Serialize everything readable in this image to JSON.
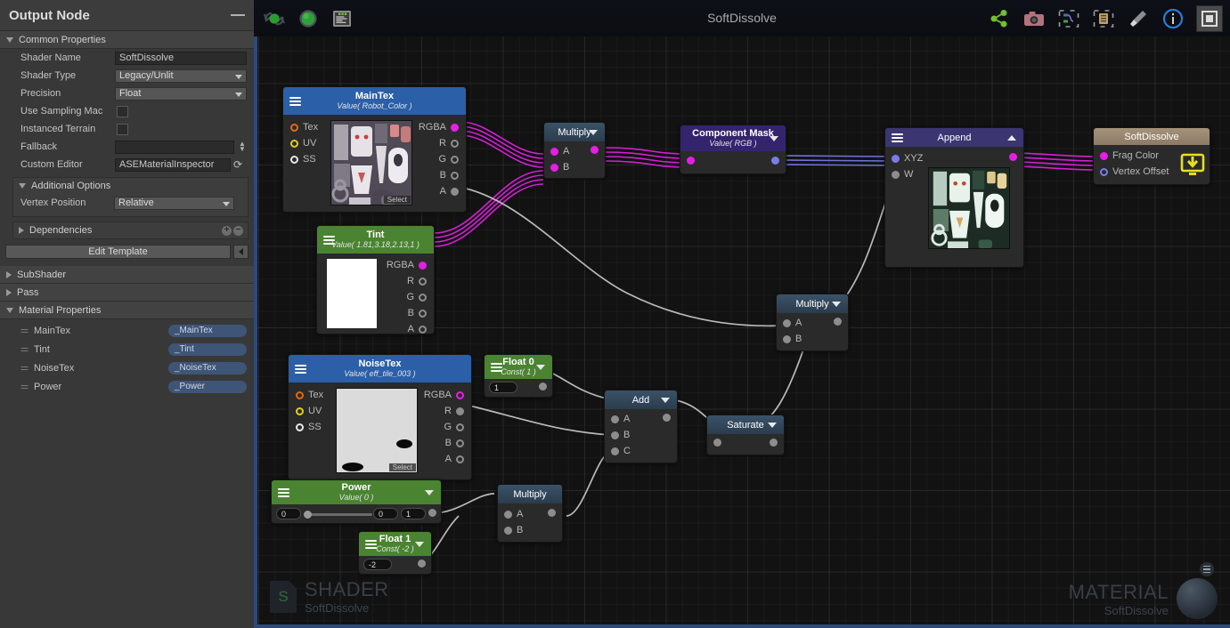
{
  "sidebar": {
    "title": "Output Node",
    "minimize_icon": "minimize-icon",
    "sections": {
      "common_properties": "Common Properties",
      "additional_options": "Additional Options",
      "dependencies": "Dependencies",
      "subshader": "SubShader",
      "pass": "Pass",
      "material_properties": "Material Properties"
    },
    "fields": {
      "shader_name_label": "Shader Name",
      "shader_name_value": "SoftDissolve",
      "shader_type_label": "Shader Type",
      "shader_type_value": "Legacy/Unlit",
      "precision_label": "Precision",
      "precision_value": "Float",
      "use_sampling_macros_label": "Use Sampling Mac",
      "instanced_terrain_label": "Instanced Terrain",
      "fallback_label": "Fallback",
      "fallback_value": "",
      "custom_editor_label": "Custom Editor",
      "custom_editor_value": "ASEMaterialInspector",
      "vertex_position_label": "Vertex Position",
      "vertex_position_value": "Relative"
    },
    "edit_template_button": "Edit Template",
    "material_properties": [
      {
        "name": "MainTex",
        "property": "_MainTex"
      },
      {
        "name": "Tint",
        "property": "_Tint"
      },
      {
        "name": "NoiseTex",
        "property": "_NoiseTex"
      },
      {
        "name": "Power",
        "property": "_Power"
      }
    ]
  },
  "graph": {
    "title": "SoftDissolve",
    "toolbar_left": [
      "live-update-icon",
      "green-sphere-icon",
      "shader-code-icon"
    ],
    "toolbar_right": [
      "share-icon",
      "camera-icon",
      "focus-nodes-icon",
      "focus-selection-icon",
      "cleanup-broom-icon",
      "info-icon",
      "minimap-panel-icon"
    ],
    "watermark_shader": {
      "kind": "SHADER",
      "name": "SoftDissolve",
      "badge": "S"
    },
    "watermark_material": {
      "kind": "MATERIAL",
      "name": "SoftDissolve"
    },
    "nodes": [
      {
        "id": "maintex",
        "title": "MainTex",
        "subtitle": "Value( Robot_Color )",
        "header_color": "#2b5fa8",
        "inputs": [
          {
            "label": "Tex",
            "style": "hollow-orange"
          },
          {
            "label": "UV",
            "style": "hollow-yellow"
          },
          {
            "label": "SS",
            "style": "hollow-white"
          }
        ],
        "outputs": [
          {
            "label": "RGBA",
            "style": "mag"
          },
          {
            "label": "R",
            "style": "hollow-grey"
          },
          {
            "label": "G",
            "style": "hollow-grey"
          },
          {
            "label": "B",
            "style": "hollow-grey"
          },
          {
            "label": "A",
            "style": "grey"
          }
        ],
        "preview": "robot-color-texture",
        "preview_label": "Select"
      },
      {
        "id": "tint",
        "title": "Tint",
        "subtitle": "Value( 1.81,3.18,2.13,1 )",
        "header_color": "#4a8431",
        "outputs": [
          {
            "label": "RGBA",
            "style": "mag"
          },
          {
            "label": "R",
            "style": "hollow-grey"
          },
          {
            "label": "G",
            "style": "hollow-grey"
          },
          {
            "label": "B",
            "style": "hollow-grey"
          },
          {
            "label": "A",
            "style": "hollow-grey"
          }
        ],
        "preview": "white-color-swatch"
      },
      {
        "id": "multiply_top",
        "title": "Multiply",
        "header_color": "#30455c",
        "inputs": [
          {
            "label": "A",
            "style": "mag"
          },
          {
            "label": "B",
            "style": "mag"
          }
        ],
        "outputs": [
          {
            "label": "",
            "style": "mag"
          }
        ]
      },
      {
        "id": "component_mask",
        "title": "Component Mask",
        "subtitle": "Value( RGB )",
        "header_color": "#34246d",
        "inputs": [
          {
            "label": "",
            "style": "mag"
          }
        ],
        "outputs": [
          {
            "label": "",
            "style": "blue"
          }
        ]
      },
      {
        "id": "append",
        "title": "Append",
        "header_color": "#3b3572",
        "inputs": [
          {
            "label": "XYZ",
            "style": "blue"
          },
          {
            "label": "W",
            "style": "grey"
          }
        ],
        "outputs": [
          {
            "label": "",
            "style": "mag"
          }
        ],
        "preview": "appended-greenish-texture"
      },
      {
        "id": "softdissolve",
        "title": "SoftDissolve",
        "header_color": "#9b8970",
        "inputs": [
          {
            "label": "Frag Color",
            "style": "mag"
          },
          {
            "label": "Vertex Offset",
            "style": "hollow-blue"
          }
        ],
        "icon": "save-to-shader-icon"
      },
      {
        "id": "noisetex",
        "title": "NoiseTex",
        "subtitle": "Value( eff_tile_003 )",
        "header_color": "#2b5fa8",
        "inputs": [
          {
            "label": "Tex",
            "style": "hollow-orange"
          },
          {
            "label": "UV",
            "style": "hollow-yellow"
          },
          {
            "label": "SS",
            "style": "hollow-white"
          }
        ],
        "outputs": [
          {
            "label": "RGBA",
            "style": "hollow-mag"
          },
          {
            "label": "R",
            "style": "grey"
          },
          {
            "label": "G",
            "style": "hollow-grey"
          },
          {
            "label": "B",
            "style": "hollow-grey"
          },
          {
            "label": "A",
            "style": "hollow-grey"
          }
        ],
        "preview": "noise-texture",
        "preview_label": "Select"
      },
      {
        "id": "float0",
        "title": "Float 0",
        "subtitle": "Const( 1 )",
        "header_color": "#4a8431",
        "value": "1",
        "outputs": [
          {
            "label": "",
            "style": "grey"
          }
        ]
      },
      {
        "id": "add",
        "title": "Add",
        "header_color": "#30455c",
        "inputs": [
          {
            "label": "A",
            "style": "grey"
          },
          {
            "label": "B",
            "style": "grey"
          },
          {
            "label": "C",
            "style": "grey"
          }
        ],
        "outputs": [
          {
            "label": "",
            "style": "grey"
          }
        ]
      },
      {
        "id": "saturate",
        "title": "Saturate",
        "header_color": "#30455c",
        "inputs": [
          {
            "label": "",
            "style": "grey"
          }
        ],
        "outputs": [
          {
            "label": "",
            "style": "grey"
          }
        ]
      },
      {
        "id": "multiply_mid",
        "title": "Multiply",
        "header_color": "#30455c",
        "inputs": [
          {
            "label": "A",
            "style": "grey"
          },
          {
            "label": "B",
            "style": "grey"
          }
        ],
        "outputs": [
          {
            "label": "",
            "style": "grey"
          }
        ]
      },
      {
        "id": "power",
        "title": "Power",
        "subtitle": "Value( 0 )",
        "header_color": "#4a8431",
        "slider_value": "0",
        "field_a": "0",
        "field_b": "1",
        "outputs": [
          {
            "label": "",
            "style": "grey"
          }
        ]
      },
      {
        "id": "multiply_bot",
        "title": "Multiply",
        "header_color": "#30455c",
        "inputs": [
          {
            "label": "A",
            "style": "grey"
          },
          {
            "label": "B",
            "style": "grey"
          }
        ],
        "outputs": [
          {
            "label": "",
            "style": "grey"
          }
        ]
      },
      {
        "id": "float1",
        "title": "Float 1",
        "subtitle": "Const( -2 )",
        "header_color": "#4a8431",
        "value": "-2",
        "outputs": [
          {
            "label": "",
            "style": "grey"
          }
        ]
      }
    ]
  }
}
